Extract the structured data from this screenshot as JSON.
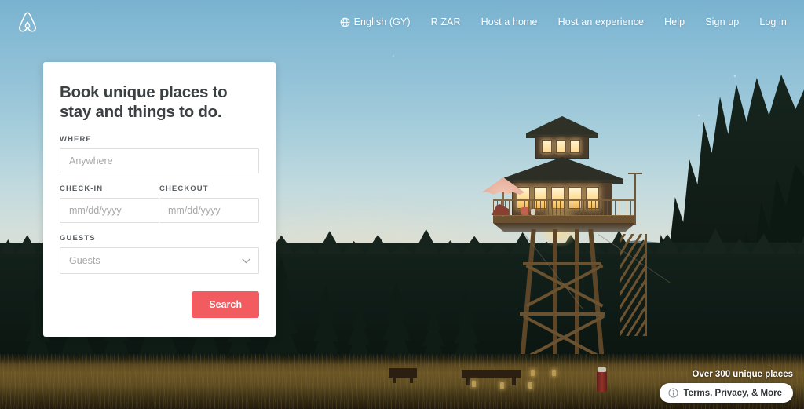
{
  "header": {
    "logo_name": "airbnb-belo-logo",
    "language": {
      "icon": "globe-icon",
      "label": "English (GY)"
    },
    "currency_label": "R ZAR",
    "nav_items": [
      {
        "label": "Host a home",
        "name": "host-a-home"
      },
      {
        "label": "Host an experience",
        "name": "host-an-experience"
      },
      {
        "label": "Help",
        "name": "help"
      },
      {
        "label": "Sign up",
        "name": "sign-up"
      },
      {
        "label": "Log in",
        "name": "log-in"
      }
    ]
  },
  "search_card": {
    "title": "Book unique places to stay and things to do.",
    "where": {
      "label": "WHERE",
      "value": "",
      "placeholder": "Anywhere"
    },
    "checkin": {
      "label": "CHECK-IN",
      "value": "",
      "placeholder": "mm/dd/yyyy"
    },
    "checkout": {
      "label": "CHECKOUT",
      "value": "",
      "placeholder": "mm/dd/yyyy"
    },
    "guests": {
      "label": "GUESTS",
      "selected": "Guests",
      "chevron_icon": "chevron-down-icon"
    },
    "search_button": "Search"
  },
  "badge": {
    "caption": "Over 300 unique places",
    "pill_icon": "info-circle-icon",
    "pill_label": "Terms, Privacy, & More"
  },
  "colors": {
    "brand_coral": "#f25b5f",
    "card_background": "#ffffff",
    "title_text": "#3b4043",
    "label_text": "#585e62",
    "placeholder_text": "#a8a8a8",
    "input_border": "#dedede",
    "nav_text": "#ffffff",
    "sky_top": "#79b2cf",
    "sky_horizon": "#dcd8ca",
    "forest_dark": "#0f1c16",
    "field_gold": "#6b5526"
  },
  "scene": {
    "description": "Fire lookout tower at dusk with lit windows, deck with umbrella, conifer forest and golden meadow"
  }
}
